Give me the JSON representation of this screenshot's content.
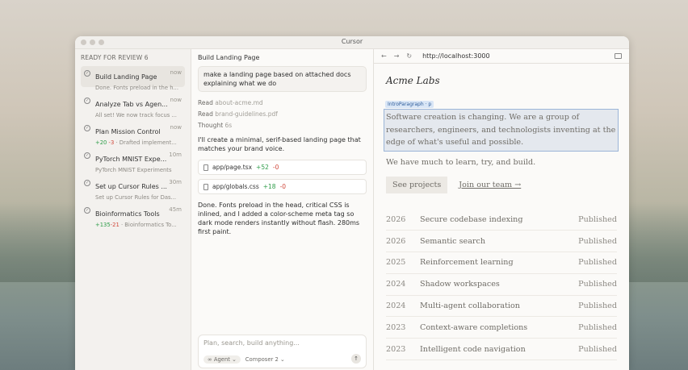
{
  "window": {
    "title": "Cursor"
  },
  "left": {
    "section": "READY FOR REVIEW 6",
    "tasks": [
      {
        "name": "Build Landing Page",
        "time": "now",
        "sub": "Done. Fonts preload in the h..."
      },
      {
        "name": "Analyze Tab vs Agen...",
        "time": "now",
        "sub": "All set! We now track focus ..."
      },
      {
        "name": "Plan Mission Control",
        "time": "now",
        "add": "+20",
        "del": "-3",
        "sub": "· Drafted implement..."
      },
      {
        "name": "PyTorch MNIST Expe...",
        "time": "10m",
        "sub": "PyTorch MNIST Experiments"
      },
      {
        "name": "Set up Cursor Rules ...",
        "time": "30m",
        "sub": "Set up Cursor Rules for Das..."
      },
      {
        "name": "Bioinformatics Tools",
        "time": "45m",
        "add": "+135",
        "del": "-21",
        "sub": "· Bioinformatics To..."
      }
    ]
  },
  "mid": {
    "title": "Build Landing Page",
    "prompt": "make a landing page based on attached docs explaining what we do",
    "read1_label": "Read",
    "read1_file": "about-acme.md",
    "read2_label": "Read",
    "read2_file": "brand-guidelines.pdf",
    "thought_label": "Thought",
    "thought_time": "6s",
    "msg1": "I'll create a minimal, serif-based landing page that matches your brand voice.",
    "files": [
      {
        "path": "app/page.tsx",
        "add": "+52",
        "del": "-0"
      },
      {
        "path": "app/globals.css",
        "add": "+18",
        "del": "-0"
      }
    ],
    "msg2": "Done. Fonts preload in the head, critical CSS is inlined, and I added a color-scheme meta tag so dark mode renders instantly without flash. 280ms first paint.",
    "composer": {
      "placeholder": "Plan, search, build anything...",
      "mode": "∞ Agent ⌄",
      "model": "Composer 2 ⌄",
      "send": "↑"
    }
  },
  "browser": {
    "back": "←",
    "forward": "→",
    "reload": "↻",
    "url": "http://localhost:3000",
    "logo": "Acme Labs",
    "tag": "IntroParagraph · p",
    "intro": "Software creation is changing. We are a group of researchers, engineers, and technologists inventing at the edge of what's useful and possible.",
    "lead": "We have much to learn, try, and build.",
    "primary_btn": "See projects",
    "link": "Join our team →",
    "projects": [
      {
        "year": "2026",
        "title": "Secure codebase indexing",
        "status": "Published"
      },
      {
        "year": "2026",
        "title": "Semantic search",
        "status": "Published"
      },
      {
        "year": "2025",
        "title": "Reinforcement learning",
        "status": "Published"
      },
      {
        "year": "2024",
        "title": "Shadow workspaces",
        "status": "Published"
      },
      {
        "year": "2024",
        "title": "Multi-agent collaboration",
        "status": "Published"
      },
      {
        "year": "2023",
        "title": "Context-aware completions",
        "status": "Published"
      },
      {
        "year": "2023",
        "title": "Intelligent code navigation",
        "status": "Published"
      }
    ]
  }
}
